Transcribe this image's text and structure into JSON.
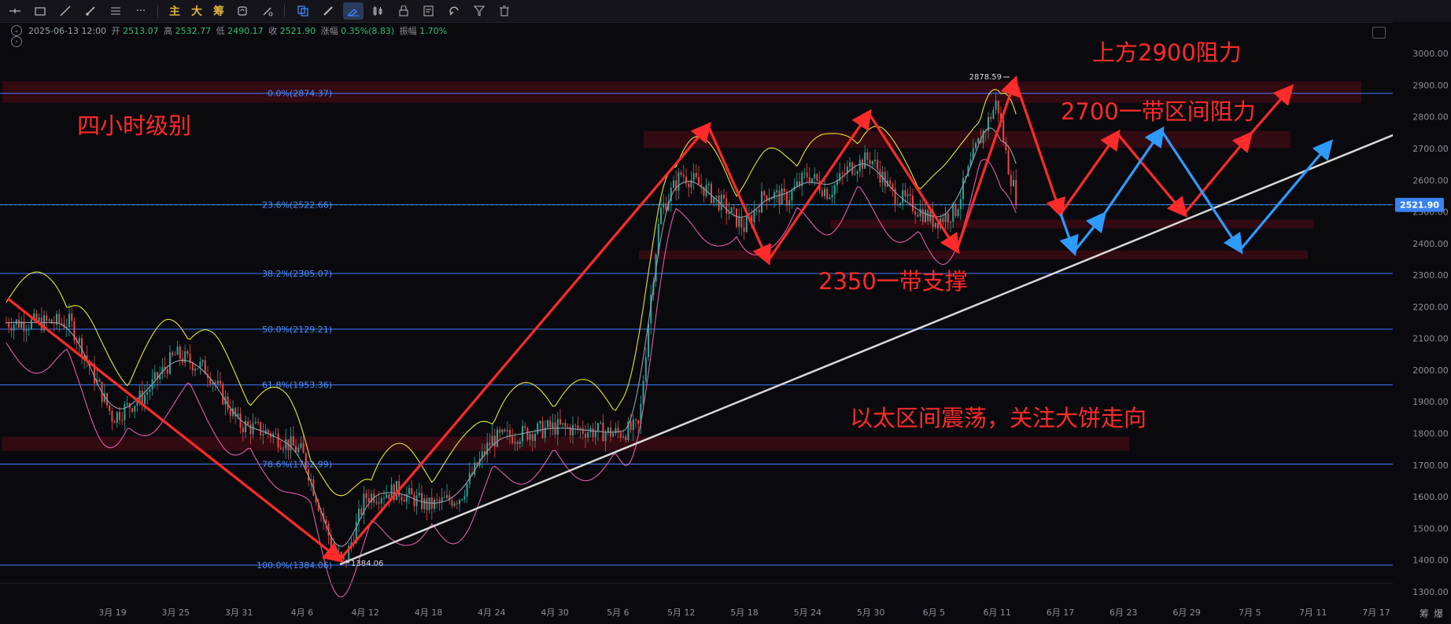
{
  "toolbar": {
    "tools": [
      "line-tool-icon",
      "rectangle-icon",
      "trend-line-icon",
      "brush-icon",
      "horizontal-lines-icon",
      "more-icon"
    ],
    "indicator_labels": [
      "主",
      "大",
      "筹"
    ],
    "tools2": [
      "copy-icon",
      "edit-icon",
      "ruler-icon",
      "candles-icon",
      "lock-icon",
      "note-icon",
      "magnet-icon",
      "filter-icon",
      "trash-icon"
    ]
  },
  "header": {
    "datetime": "2025-06-13 12:00",
    "open_label": "开",
    "open": "2513.07",
    "high_label": "高",
    "high": "2532.77",
    "low_label": "低",
    "low": "2490.17",
    "close_label": "收",
    "close": "2521.90",
    "change_label": "涨幅",
    "change": "0.35%(8.83)",
    "amp_label": "振幅",
    "amp": "1.70%"
  },
  "annotations": {
    "timeframe": "四小时级别",
    "resistance_top": "上方2900阻力",
    "resistance_mid": "2700一带区间阻力",
    "support": "2350一带支撑",
    "summary": "以太区间震荡，关注大饼走向",
    "high_marker": "2878.59",
    "low_marker": "1384.06"
  },
  "footer": {
    "settings_label": "筹",
    "extra_label": "爆"
  },
  "colors": {
    "background": "#0a0a0e",
    "fib_line": "#3c7cff",
    "zone": "#3a0a12",
    "annotation": "#ff2a2a",
    "blue_arrow": "#2e9bff",
    "trendline": "#d8d8d8",
    "price_tag": "#3a82f0"
  },
  "chart_data": {
    "type": "candlestick",
    "symbol_price": "2521.90",
    "y_range": [
      1250,
      3050
    ],
    "y_ticks": [
      "3000.00",
      "2900.00",
      "2800.00",
      "2700.00",
      "2600.00",
      "2500.00",
      "2400.00",
      "2300.00",
      "2200.00",
      "2100.00",
      "2000.00",
      "1900.00",
      "1800.00",
      "1700.00",
      "1600.00",
      "1500.00",
      "1400.00",
      "1300.00"
    ],
    "x_ticks": [
      "3月 19",
      "3月 25",
      "3月 31",
      "4月 6",
      "4月 12",
      "4月 18",
      "4月 24",
      "4月 30",
      "5月 6",
      "5月 12",
      "5月 18",
      "5月 24",
      "5月 30",
      "6月 5",
      "6月 11",
      "6月 17",
      "6月 23",
      "6月 29",
      "7月 5",
      "7月 11",
      "7月 17"
    ],
    "fib_levels": [
      {
        "label": "0.0%(2874.37)",
        "price": 2874.37
      },
      {
        "label": "23.6%(2522.66)",
        "price": 2522.66
      },
      {
        "label": "38.2%(2305.07)",
        "price": 2305.07
      },
      {
        "label": "50.0%(2129.21)",
        "price": 2129.21
      },
      {
        "label": "61.8%(1953.36)",
        "price": 1953.36
      },
      {
        "label": "78.6%(1702.99)",
        "price": 1702.99
      },
      {
        "label": "100.0%(1384.06)",
        "price": 1384.06
      }
    ],
    "zones": [
      {
        "from": 2845,
        "to": 2912
      },
      {
        "from": 2702,
        "to": 2755
      },
      {
        "from": 2448,
        "to": 2475
      },
      {
        "from": 2350,
        "to": 2378
      },
      {
        "from": 1745,
        "to": 1790
      }
    ],
    "price_path": [
      [
        "3月 15",
        2150
      ],
      [
        "3月 19",
        1850
      ],
      [
        "3月 22",
        1920
      ],
      [
        "3月 25",
        2050
      ],
      [
        "3月 28",
        2000
      ],
      [
        "3月 31",
        1830
      ],
      [
        "4月 3",
        1800
      ],
      [
        "4月 6",
        1740
      ],
      [
        "4月 9",
        1430
      ],
      [
        "4月 10",
        1384
      ],
      [
        "4月 12",
        1600
      ],
      [
        "4月 15",
        1620
      ],
      [
        "4月 18",
        1570
      ],
      [
        "4月 21",
        1600
      ],
      [
        "4月 24",
        1780
      ],
      [
        "4月 27",
        1800
      ],
      [
        "4月 30",
        1820
      ],
      [
        "5月 3",
        1810
      ],
      [
        "5月 6",
        1800
      ],
      [
        "5月 8",
        1820
      ],
      [
        "5月 9",
        2200
      ],
      [
        "5月 10",
        2500
      ],
      [
        "5月 12",
        2620
      ],
      [
        "5月 14",
        2580
      ],
      [
        "5月 16",
        2520
      ],
      [
        "5月 18",
        2450
      ],
      [
        "5月 20",
        2560
      ],
      [
        "5月 22",
        2540
      ],
      [
        "5月 24",
        2620
      ],
      [
        "5月 26",
        2560
      ],
      [
        "5月 28",
        2640
      ],
      [
        "5月 30",
        2670
      ],
      [
        "6月 1",
        2560
      ],
      [
        "6月 3",
        2520
      ],
      [
        "6月 5",
        2470
      ],
      [
        "6月 7",
        2500
      ],
      [
        "6月 9",
        2700
      ],
      [
        "6月 11",
        2850
      ],
      [
        "6月 12",
        2650
      ],
      [
        "6月 13",
        2522
      ]
    ]
  }
}
